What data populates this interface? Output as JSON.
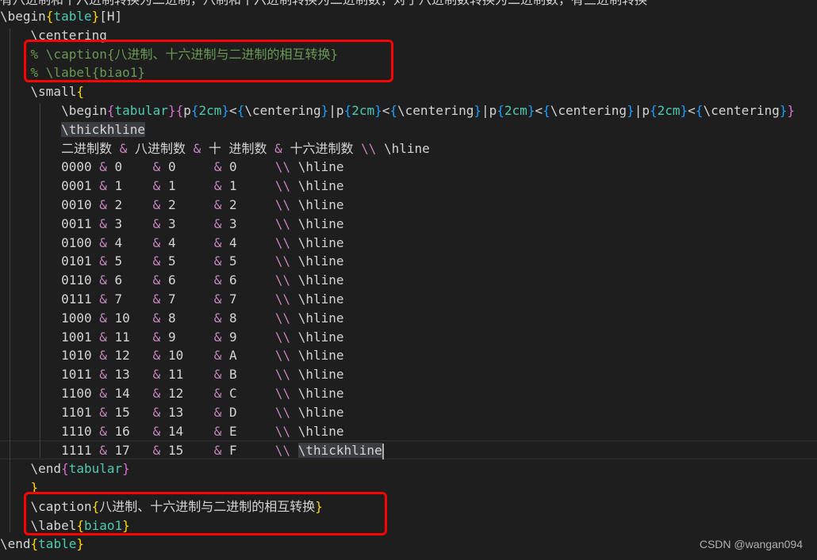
{
  "top_partial": "有八进制和十六进制转换为二进制，八制和十六进制转换为二进制数，对于八进制数转换为二进制数，有三进制转换",
  "lines": [
    [
      [
        "\\begin",
        "cmd"
      ],
      [
        "{",
        "b1"
      ],
      [
        "table",
        "arg"
      ],
      [
        "}",
        "b1"
      ],
      [
        "[H]",
        "cmd"
      ]
    ],
    [
      [
        "    \\centering",
        "cmd"
      ]
    ],
    [
      [
        "    % \\caption{八进制、十六进制与二进制的相互转换}",
        "cm"
      ]
    ],
    [
      [
        "    % \\label{biao1}",
        "cm"
      ]
    ],
    [
      [
        "    \\small",
        "cmd"
      ],
      [
        "{",
        "b1"
      ]
    ],
    [
      [
        "        \\begin",
        "cmd"
      ],
      [
        "{",
        "b2"
      ],
      [
        "tabular",
        "arg"
      ],
      [
        "}",
        "b2"
      ],
      [
        "{",
        "b2"
      ],
      [
        "p",
        "cmd"
      ],
      [
        "{",
        "b3"
      ],
      [
        "2cm",
        "arg"
      ],
      [
        "}",
        "b3"
      ],
      [
        "<",
        "cmd"
      ],
      [
        "{",
        "b3"
      ],
      [
        "\\centering",
        "cmd"
      ],
      [
        "}",
        "b3"
      ],
      [
        "|p",
        "cmd"
      ],
      [
        "{",
        "b3"
      ],
      [
        "2cm",
        "arg"
      ],
      [
        "}",
        "b3"
      ],
      [
        "<",
        "cmd"
      ],
      [
        "{",
        "b3"
      ],
      [
        "\\centering",
        "cmd"
      ],
      [
        "}",
        "b3"
      ],
      [
        "|p",
        "cmd"
      ],
      [
        "{",
        "b3"
      ],
      [
        "2cm",
        "arg"
      ],
      [
        "}",
        "b3"
      ],
      [
        "<",
        "cmd"
      ],
      [
        "{",
        "b3"
      ],
      [
        "\\centering",
        "cmd"
      ],
      [
        "}",
        "b3"
      ],
      [
        "|p",
        "cmd"
      ],
      [
        "{",
        "b3"
      ],
      [
        "2cm",
        "arg"
      ],
      [
        "}",
        "b3"
      ],
      [
        "<",
        "cmd"
      ],
      [
        "{",
        "b3"
      ],
      [
        "\\centering",
        "cmd"
      ],
      [
        "}",
        "b3"
      ],
      [
        "}",
        "b2"
      ]
    ],
    [
      [
        "        ",
        "cmd"
      ],
      [
        "\\thickhline",
        "hl"
      ]
    ],
    [
      [
        "        二进制数 ",
        "cmd"
      ],
      [
        "&",
        "amp"
      ],
      [
        " 八进制数 ",
        "cmd"
      ],
      [
        "&",
        "amp"
      ],
      [
        " 十 进制数 ",
        "cmd"
      ],
      [
        "&",
        "amp"
      ],
      [
        " 十六进制数 ",
        "cmd"
      ],
      [
        "\\\\",
        "bs"
      ],
      [
        " \\hline",
        "cmd"
      ]
    ],
    [
      [
        "        0000 ",
        "cmd"
      ],
      [
        "&",
        "amp"
      ],
      [
        " 0    ",
        "cmd"
      ],
      [
        "&",
        "amp"
      ],
      [
        " 0     ",
        "cmd"
      ],
      [
        "&",
        "amp"
      ],
      [
        " 0     ",
        "cmd"
      ],
      [
        "\\\\",
        "bs"
      ],
      [
        " \\hline",
        "cmd"
      ]
    ],
    [
      [
        "        0001 ",
        "cmd"
      ],
      [
        "&",
        "amp"
      ],
      [
        " 1    ",
        "cmd"
      ],
      [
        "&",
        "amp"
      ],
      [
        " 1     ",
        "cmd"
      ],
      [
        "&",
        "amp"
      ],
      [
        " 1     ",
        "cmd"
      ],
      [
        "\\\\",
        "bs"
      ],
      [
        " \\hline",
        "cmd"
      ]
    ],
    [
      [
        "        0010 ",
        "cmd"
      ],
      [
        "&",
        "amp"
      ],
      [
        " 2    ",
        "cmd"
      ],
      [
        "&",
        "amp"
      ],
      [
        " 2     ",
        "cmd"
      ],
      [
        "&",
        "amp"
      ],
      [
        " 2     ",
        "cmd"
      ],
      [
        "\\\\",
        "bs"
      ],
      [
        " \\hline",
        "cmd"
      ]
    ],
    [
      [
        "        0011 ",
        "cmd"
      ],
      [
        "&",
        "amp"
      ],
      [
        " 3    ",
        "cmd"
      ],
      [
        "&",
        "amp"
      ],
      [
        " 3     ",
        "cmd"
      ],
      [
        "&",
        "amp"
      ],
      [
        " 3     ",
        "cmd"
      ],
      [
        "\\\\",
        "bs"
      ],
      [
        " \\hline",
        "cmd"
      ]
    ],
    [
      [
        "        0100 ",
        "cmd"
      ],
      [
        "&",
        "amp"
      ],
      [
        " 4    ",
        "cmd"
      ],
      [
        "&",
        "amp"
      ],
      [
        " 4     ",
        "cmd"
      ],
      [
        "&",
        "amp"
      ],
      [
        " 4     ",
        "cmd"
      ],
      [
        "\\\\",
        "bs"
      ],
      [
        " \\hline",
        "cmd"
      ]
    ],
    [
      [
        "        0101 ",
        "cmd"
      ],
      [
        "&",
        "amp"
      ],
      [
        " 5    ",
        "cmd"
      ],
      [
        "&",
        "amp"
      ],
      [
        " 5     ",
        "cmd"
      ],
      [
        "&",
        "amp"
      ],
      [
        " 5     ",
        "cmd"
      ],
      [
        "\\\\",
        "bs"
      ],
      [
        " \\hline",
        "cmd"
      ]
    ],
    [
      [
        "        0110 ",
        "cmd"
      ],
      [
        "&",
        "amp"
      ],
      [
        " 6    ",
        "cmd"
      ],
      [
        "&",
        "amp"
      ],
      [
        " 6     ",
        "cmd"
      ],
      [
        "&",
        "amp"
      ],
      [
        " 6     ",
        "cmd"
      ],
      [
        "\\\\",
        "bs"
      ],
      [
        " \\hline",
        "cmd"
      ]
    ],
    [
      [
        "        0111 ",
        "cmd"
      ],
      [
        "&",
        "amp"
      ],
      [
        " 7    ",
        "cmd"
      ],
      [
        "&",
        "amp"
      ],
      [
        " 7     ",
        "cmd"
      ],
      [
        "&",
        "amp"
      ],
      [
        " 7     ",
        "cmd"
      ],
      [
        "\\\\",
        "bs"
      ],
      [
        " \\hline",
        "cmd"
      ]
    ],
    [
      [
        "        1000 ",
        "cmd"
      ],
      [
        "&",
        "amp"
      ],
      [
        " 10   ",
        "cmd"
      ],
      [
        "&",
        "amp"
      ],
      [
        " 8     ",
        "cmd"
      ],
      [
        "&",
        "amp"
      ],
      [
        " 8     ",
        "cmd"
      ],
      [
        "\\\\",
        "bs"
      ],
      [
        " \\hline",
        "cmd"
      ]
    ],
    [
      [
        "        1001 ",
        "cmd"
      ],
      [
        "&",
        "amp"
      ],
      [
        " 11   ",
        "cmd"
      ],
      [
        "&",
        "amp"
      ],
      [
        " 9     ",
        "cmd"
      ],
      [
        "&",
        "amp"
      ],
      [
        " 9     ",
        "cmd"
      ],
      [
        "\\\\",
        "bs"
      ],
      [
        " \\hline",
        "cmd"
      ]
    ],
    [
      [
        "        1010 ",
        "cmd"
      ],
      [
        "&",
        "amp"
      ],
      [
        " 12   ",
        "cmd"
      ],
      [
        "&",
        "amp"
      ],
      [
        " 10    ",
        "cmd"
      ],
      [
        "&",
        "amp"
      ],
      [
        " A     ",
        "cmd"
      ],
      [
        "\\\\",
        "bs"
      ],
      [
        " \\hline",
        "cmd"
      ]
    ],
    [
      [
        "        1011 ",
        "cmd"
      ],
      [
        "&",
        "amp"
      ],
      [
        " 13   ",
        "cmd"
      ],
      [
        "&",
        "amp"
      ],
      [
        " 11    ",
        "cmd"
      ],
      [
        "&",
        "amp"
      ],
      [
        " B     ",
        "cmd"
      ],
      [
        "\\\\",
        "bs"
      ],
      [
        " \\hline",
        "cmd"
      ]
    ],
    [
      [
        "        1100 ",
        "cmd"
      ],
      [
        "&",
        "amp"
      ],
      [
        " 14   ",
        "cmd"
      ],
      [
        "&",
        "amp"
      ],
      [
        " 12    ",
        "cmd"
      ],
      [
        "&",
        "amp"
      ],
      [
        " C     ",
        "cmd"
      ],
      [
        "\\\\",
        "bs"
      ],
      [
        " \\hline",
        "cmd"
      ]
    ],
    [
      [
        "        1101 ",
        "cmd"
      ],
      [
        "&",
        "amp"
      ],
      [
        " 15   ",
        "cmd"
      ],
      [
        "&",
        "amp"
      ],
      [
        " 13    ",
        "cmd"
      ],
      [
        "&",
        "amp"
      ],
      [
        " D     ",
        "cmd"
      ],
      [
        "\\\\",
        "bs"
      ],
      [
        " \\hline",
        "cmd"
      ]
    ],
    [
      [
        "        1110 ",
        "cmd"
      ],
      [
        "&",
        "amp"
      ],
      [
        " 16   ",
        "cmd"
      ],
      [
        "&",
        "amp"
      ],
      [
        " 14    ",
        "cmd"
      ],
      [
        "&",
        "amp"
      ],
      [
        " E     ",
        "cmd"
      ],
      [
        "\\\\",
        "bs"
      ],
      [
        " \\hline",
        "cmd"
      ]
    ],
    [
      [
        "        1111 ",
        "cmd"
      ],
      [
        "&",
        "amp"
      ],
      [
        " 17   ",
        "cmd"
      ],
      [
        "&",
        "amp"
      ],
      [
        " 15    ",
        "cmd"
      ],
      [
        "&",
        "amp"
      ],
      [
        " F     ",
        "cmd"
      ],
      [
        "\\\\",
        "bs"
      ],
      [
        " ",
        "cmd"
      ],
      [
        "\\thickhline",
        "hl"
      ]
    ],
    [
      [
        "    \\end",
        "cmd"
      ],
      [
        "{",
        "b2"
      ],
      [
        "tabular",
        "arg"
      ],
      [
        "}",
        "b2"
      ]
    ],
    [
      [
        "    ",
        "cmd"
      ],
      [
        "}",
        "b1"
      ]
    ],
    [
      [
        "    \\caption",
        "cmd"
      ],
      [
        "{",
        "b1"
      ],
      [
        "八进制、十六进制与二进制的相互转换",
        "cmd"
      ],
      [
        "}",
        "b1"
      ]
    ],
    [
      [
        "    \\label",
        "cmd"
      ],
      [
        "{",
        "b1"
      ],
      [
        "biao1",
        "arg"
      ],
      [
        "}",
        "b1"
      ]
    ],
    [
      [
        "\\end",
        "cmd"
      ],
      [
        "{",
        "b1"
      ],
      [
        "table",
        "arg"
      ],
      [
        "}",
        "b1"
      ]
    ]
  ],
  "watermark": "CSDN @wangan094",
  "colors": {
    "background": "#1e1e1e",
    "red_highlight": "#ff0000",
    "comment": "#6a9955",
    "keyword_arg": "#4ec9b0",
    "bracket_gold": "#ffd700",
    "bracket_purple": "#da70d6",
    "bracket_blue": "#179fff"
  }
}
